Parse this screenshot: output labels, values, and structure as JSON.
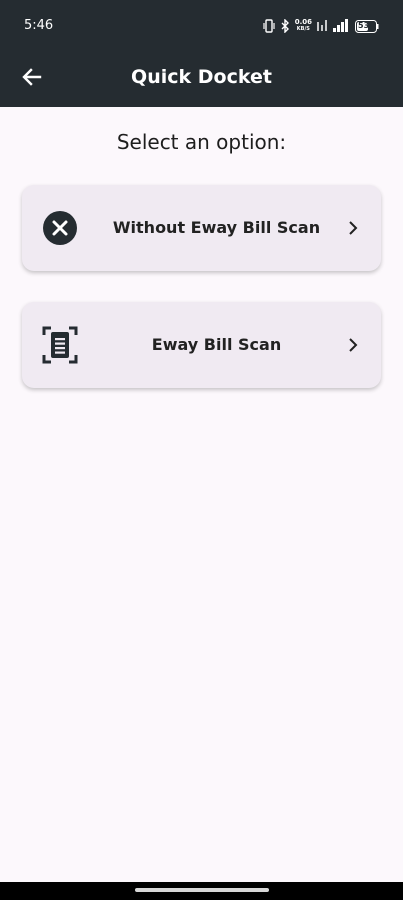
{
  "status_bar": {
    "time": "5:46",
    "net_speed_value": "0.06",
    "net_speed_unit": "KB/S",
    "battery_level": "53"
  },
  "app_bar": {
    "title": "Quick Docket"
  },
  "main": {
    "heading": "Select an option:",
    "options": [
      {
        "label": "Without Eway Bill Scan",
        "icon": "close-circle-icon"
      },
      {
        "label": "Eway Bill Scan",
        "icon": "document-scanner-icon"
      }
    ]
  },
  "colors": {
    "app_bar_bg": "#252c31",
    "page_bg": "#fcf8fc",
    "card_bg": "#f0eaf2",
    "icon_dark": "#252c31"
  }
}
